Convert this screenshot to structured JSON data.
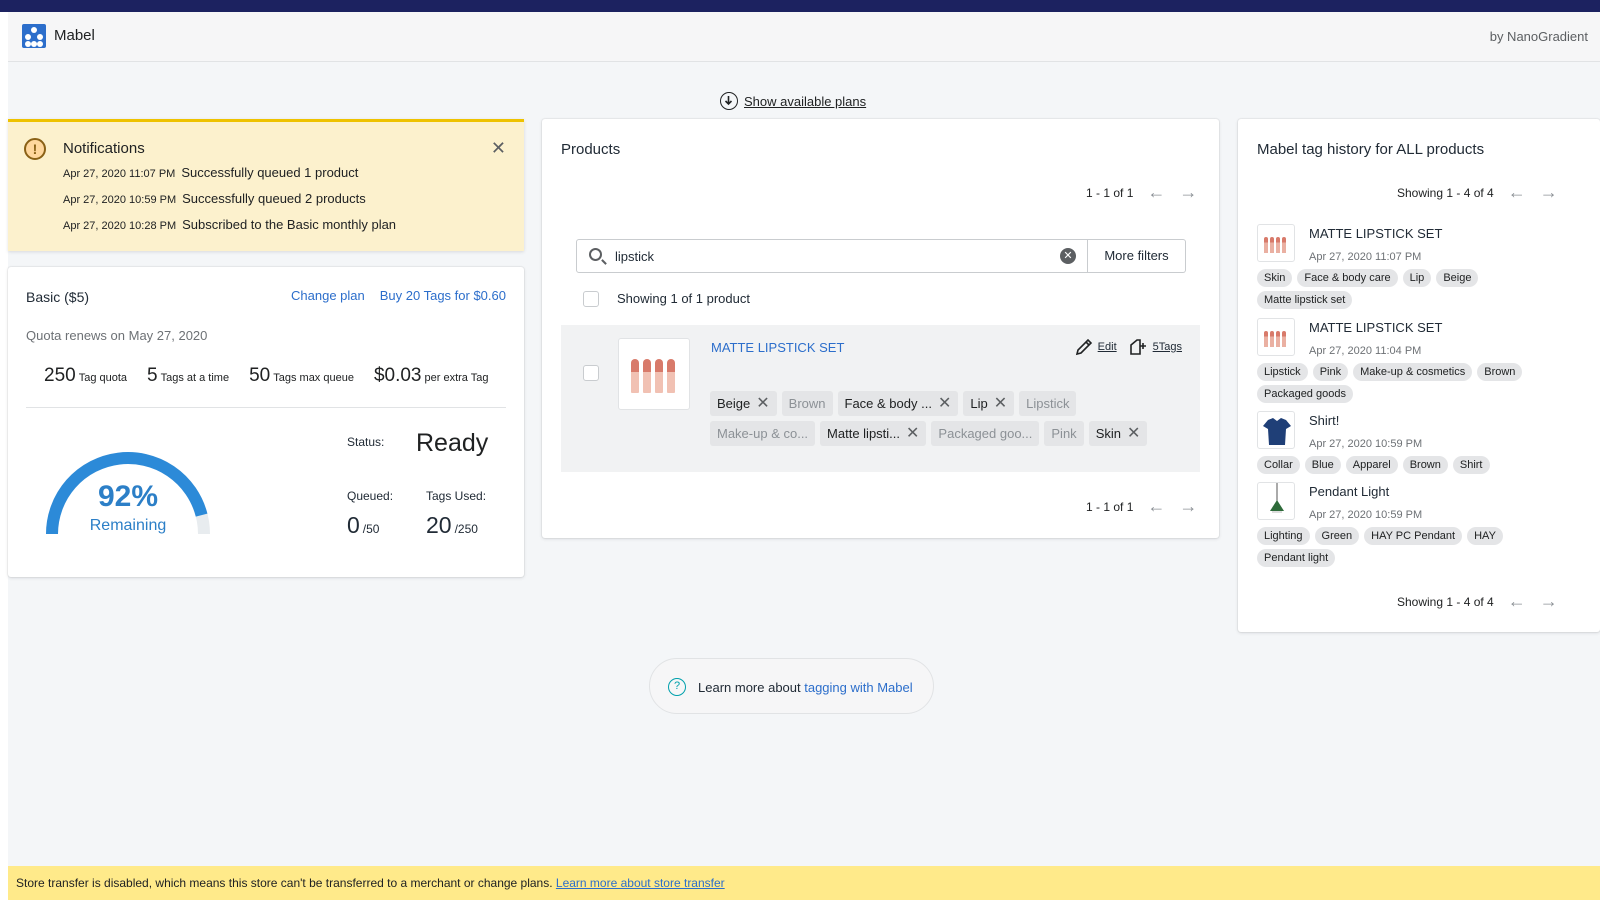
{
  "header": {
    "app_name": "Mabel",
    "by": "by NanoGradient"
  },
  "show_plans": "Show available plans",
  "notifications": {
    "title": "Notifications",
    "items": [
      {
        "date": "Apr 27, 2020 11:07 PM",
        "text": "Successfully queued 1 product"
      },
      {
        "date": "Apr 27, 2020 10:59 PM",
        "text": "Successfully queued 2 products"
      },
      {
        "date": "Apr 27, 2020 10:28 PM",
        "text": "Subscribed to the Basic monthly plan"
      }
    ]
  },
  "plan": {
    "name": "Basic ($5)",
    "change_plan": "Change plan",
    "buy_tags": "Buy 20 Tags for $0.60",
    "renews": "Quota renews on May 27, 2020",
    "stats": [
      {
        "value": "250",
        "label": "Tag quota"
      },
      {
        "value": "5",
        "label": "Tags at a time"
      },
      {
        "value": "50",
        "label": "Tags max queue"
      },
      {
        "value": "$0.03",
        "label": "per extra Tag"
      }
    ],
    "gauge_percent": "92%",
    "gauge_fraction": 0.92,
    "gauge_label": "Remaining",
    "status_label": "Status:",
    "status_value": "Ready",
    "queued_label": "Queued:",
    "queued_value": "0",
    "queued_max": "/50",
    "tags_used_label": "Tags Used:",
    "tags_used_value": "20",
    "tags_used_max": "/250"
  },
  "products": {
    "title": "Products",
    "pager": "1 - 1 of 1",
    "search_value": "lipstick",
    "more_filters": "More filters",
    "showing": "Showing 1 of 1 product",
    "product": {
      "name": "MATTE LIPSTICK SET",
      "edit": "Edit",
      "tags_link": "5Tags",
      "tags": [
        {
          "label": "Beige",
          "active": true
        },
        {
          "label": "Brown",
          "active": false
        },
        {
          "label": "Face & body ...",
          "active": true
        },
        {
          "label": "Lip",
          "active": true
        },
        {
          "label": "Lipstick",
          "active": false
        },
        {
          "label": "Make-up & co...",
          "active": false
        },
        {
          "label": "Matte lipsti...",
          "active": true
        },
        {
          "label": "Packaged goo...",
          "active": false
        },
        {
          "label": "Pink",
          "active": false
        },
        {
          "label": "Skin",
          "active": true
        }
      ]
    }
  },
  "history": {
    "title": "Mabel tag history for ALL products",
    "pager": "Showing 1 - 4 of 4",
    "items": [
      {
        "name": "MATTE LIPSTICK SET",
        "date": "Apr 27, 2020 11:07 PM",
        "thumb": "lipstick",
        "tags": [
          "Skin",
          "Face & body care",
          "Lip",
          "Beige",
          "Matte lipstick set"
        ]
      },
      {
        "name": "MATTE LIPSTICK SET",
        "date": "Apr 27, 2020 11:04 PM",
        "thumb": "lipstick",
        "tags": [
          "Lipstick",
          "Pink",
          "Make-up & cosmetics",
          "Brown",
          "Packaged goods"
        ]
      },
      {
        "name": "Shirt!",
        "date": "Apr 27, 2020 10:59 PM",
        "thumb": "shirt",
        "tags": [
          "Collar",
          "Blue",
          "Apparel",
          "Brown",
          "Shirt"
        ]
      },
      {
        "name": "Pendant Light",
        "date": "Apr 27, 2020 10:59 PM",
        "thumb": "lamp",
        "tags": [
          "Lighting",
          "Green",
          "HAY PC Pendant",
          "HAY",
          "Pendant light"
        ]
      }
    ]
  },
  "learn": {
    "prefix": "Learn more about ",
    "link": "tagging with Mabel"
  },
  "banner": {
    "text": "Store transfer is disabled, which means this store can't be transferred to a merchant or change plans. ",
    "link": "Learn more about store transfer"
  },
  "colors": {
    "accent": "#2c6ecb",
    "gauge": "#2c7fc7",
    "warning_bg": "#fcf1cd",
    "banner_bg": "#ffea8a",
    "topbar": "#1c2260"
  }
}
